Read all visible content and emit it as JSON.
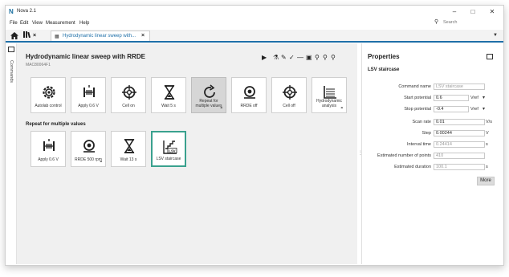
{
  "window": {
    "title": "Nova 2.1",
    "controls": [
      "–",
      "□",
      "✕"
    ]
  },
  "menu": {
    "items": [
      "File",
      "Edit",
      "View",
      "Measurement",
      "Help"
    ]
  },
  "search": {
    "placeholder": "Search"
  },
  "tabs": {
    "library_close": "×",
    "document": {
      "label": "Hydrodynamic linear sweep with...",
      "close": "×"
    }
  },
  "sidebar": {
    "label": "Commands"
  },
  "procedure": {
    "title": "Hydrodynamic linear sweep with RRDE",
    "subtitle": "MAC80064F1"
  },
  "commands": [
    {
      "label": "Autolab control",
      "icon": "gear-icon"
    },
    {
      "label": "Apply 0.6 V",
      "icon": "apply-potential-icon"
    },
    {
      "label": "Cell on",
      "icon": "cell-icon"
    },
    {
      "label": "Wait 5 s",
      "icon": "hourglass-icon"
    },
    {
      "label": "Repeat for multiple values",
      "icon": "repeat-icon"
    },
    {
      "label": "RRDE off",
      "icon": "rrde-icon"
    },
    {
      "label": "Cell off",
      "icon": "cell-icon"
    },
    {
      "label": "Hydrodynamic analysis",
      "icon": "analysis-icon"
    }
  ],
  "repeat": {
    "heading": "Repeat for multiple values",
    "commands": [
      {
        "label": "Apply 0.6 V",
        "icon": "apply-potential-icon"
      },
      {
        "label": "RRDE 500 rpm",
        "icon": "rrde-icon"
      },
      {
        "label": "Wait 13 s",
        "icon": "hourglass-icon"
      },
      {
        "label": "LSV staircase",
        "icon": "lsv-icon"
      }
    ]
  },
  "properties": {
    "title": "Properties",
    "subtitle": "LSV staircase",
    "rows": [
      {
        "label": "Command name",
        "value": "LSV staircase",
        "unit": ""
      },
      {
        "label": "Start potential",
        "value": "0.6",
        "unit": "Vref"
      },
      {
        "label": "Stop potential",
        "value": "-0.4",
        "unit": "Vref"
      },
      {
        "label": "Scan rate",
        "value": "0.01",
        "unit": "V/s"
      },
      {
        "label": "Step",
        "value": "0.00244",
        "unit": "V"
      },
      {
        "label": "Interval time",
        "value": "0.24414",
        "unit": "s"
      },
      {
        "label": "Estimated number of points",
        "value": "410",
        "unit": ""
      },
      {
        "label": "Estimated duration",
        "value": "100.1",
        "unit": "s"
      }
    ],
    "more_label": "More"
  },
  "colors": {
    "accent": "#1e6fa8",
    "selection": "#3aa18e"
  }
}
